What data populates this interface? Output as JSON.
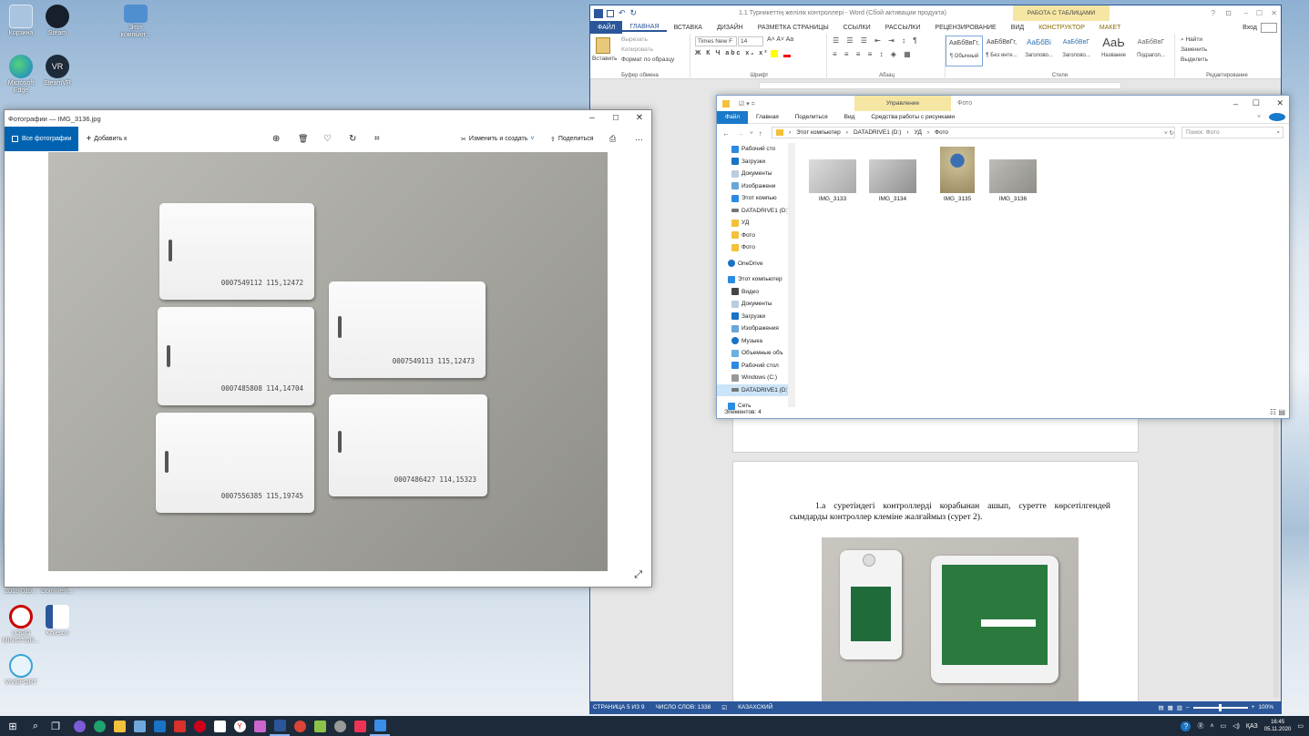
{
  "desktop": {
    "icons": [
      {
        "label": "Корзина"
      },
      {
        "label": "Steam"
      },
      {
        "label": "Этот компьют..."
      },
      {
        "label": "Microsoft Edge"
      },
      {
        "label": "SteamVR"
      },
      {
        "label": "2018-019..."
      },
      {
        "label": "Comment..."
      },
      {
        "label": "LOGO MINIOTGR..."
      },
      {
        "label": "Kolesov"
      },
      {
        "label": "VIVEPORT"
      }
    ]
  },
  "photos": {
    "title": "Фотографии — IMG_3136.jpg",
    "all_photos": "Все фотографии",
    "add": "Добавить к",
    "edit_create": "Изменить и создать",
    "share": "Поделиться",
    "cards": [
      {
        "number": "0007549112 115,12472"
      },
      {
        "number": "0007485808 114,14704"
      },
      {
        "number": "0007556385 115,19745"
      },
      {
        "number": "0007549113 115,12473"
      },
      {
        "number": "0007486427 114,15323"
      }
    ]
  },
  "word": {
    "title": "1.1 Турникеттің желілік контроллері - Word (Сбой активации продукта)",
    "table_tools": "РАБОТА С ТАБЛИЦАМИ",
    "signin": "Вход",
    "tabs": [
      "ФАЙЛ",
      "ГЛАВНАЯ",
      "ВСТАВКА",
      "ДИЗАЙН",
      "РАЗМЕТКА СТРАНИЦЫ",
      "ССЫЛКИ",
      "РАССЫЛКИ",
      "РЕЦЕНЗИРОВАНИЕ",
      "ВИД",
      "КОНСТРУКТОР",
      "МАКЕТ"
    ],
    "ribbon": {
      "paste": "Вставить",
      "cut": "Вырезать",
      "copy": "Копировать",
      "format_painter": "Формат по образцу",
      "clipboard": "Буфер обмена",
      "font_name": "Times New F",
      "font_size": "14",
      "font": "Шрифт",
      "paragraph": "Абзац",
      "styles": "Стили",
      "find": "Найти",
      "replace": "Заменить",
      "select": "Выделить",
      "editing": "Редактирование",
      "style_items": [
        {
          "preview": "АаБбВвГг,",
          "name": "¶ Обычный"
        },
        {
          "preview": "АаБбВвГг,",
          "name": "¶ Без инте..."
        },
        {
          "preview": "АаБбВі",
          "name": "Заголово..."
        },
        {
          "preview": "АаБбВвГ",
          "name": "Заголово..."
        },
        {
          "preview": "АаЬ",
          "name": "Название"
        },
        {
          "preview": "АаБбВвГ",
          "name": "Подзагол..."
        }
      ]
    },
    "body_text": "1.а суретіндегі контроллерді корабынан ашып, суретте көрсетілгендей сымдарды контроллер клеміне жалғаймыз (сурет 2).",
    "status": {
      "page": "СТРАНИЦА 5 ИЗ 9",
      "words": "ЧИСЛО СЛОВ: 1338",
      "lang": "КАЗАХСКИЙ",
      "zoom": "100%"
    }
  },
  "explorer": {
    "manage": "Управление",
    "folder": "Фото",
    "tabs": [
      "Файл",
      "Главная",
      "Поделиться",
      "Вид",
      "Средства работы с рисунками"
    ],
    "path": [
      "Этот компьютер",
      "DATADRIVE1 (D:)",
      "УД",
      "Фото"
    ],
    "search_placeholder": "Поиск: Фото",
    "nav": [
      {
        "label": "Рабочий сто"
      },
      {
        "label": "Загрузки"
      },
      {
        "label": "Документы"
      },
      {
        "label": "Изображени"
      },
      {
        "label": "Этот компью"
      },
      {
        "label": "DATADRIVE1 (D:)"
      },
      {
        "label": "УД"
      },
      {
        "label": "Фото"
      },
      {
        "label": "Фото"
      },
      {
        "label": "OneDrive"
      },
      {
        "label": "Этот компьютер"
      },
      {
        "label": "Видео"
      },
      {
        "label": "Документы"
      },
      {
        "label": "Загрузки"
      },
      {
        "label": "Изображения"
      },
      {
        "label": "Музыка"
      },
      {
        "label": "Объемные объ"
      },
      {
        "label": "Рабочий стол"
      },
      {
        "label": "Windows (C:)"
      },
      {
        "label": "DATADRIVE1 (D:)"
      },
      {
        "label": "Сеть"
      }
    ],
    "files": [
      {
        "name": "IMG_3133"
      },
      {
        "name": "IMG_3134"
      },
      {
        "name": "IMG_3135"
      },
      {
        "name": "IMG_3136"
      }
    ],
    "count": "Элементов: 4"
  },
  "tray": {
    "lang": "ҚАЗ",
    "time": "16:45",
    "date": "05.11.2020"
  },
  "colors": {
    "word_blue": "#2b579a",
    "photos_accent": "#0063b1",
    "taskbar": "#1d2a3a",
    "table_tools": "#f5e6a4"
  }
}
